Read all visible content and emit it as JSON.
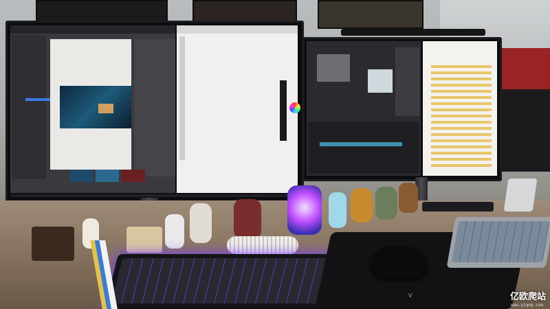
{
  "scene": {
    "description_kind": "photo",
    "colors": {
      "wall": "#a9acab",
      "desk": "#8a7763",
      "screen_light": "#efeeec",
      "screen_dark": "#2b2b2f",
      "rgb_glow": "#9a5bff",
      "speaker_glow": "#c04dff"
    }
  },
  "watermark": {
    "brand": "亿欧爬站",
    "url": "www.yiqog.com"
  },
  "icons": [
    "monitor-icon",
    "keyboard-icon",
    "mouse-icon",
    "speaker-icon",
    "figurine-icon"
  ]
}
